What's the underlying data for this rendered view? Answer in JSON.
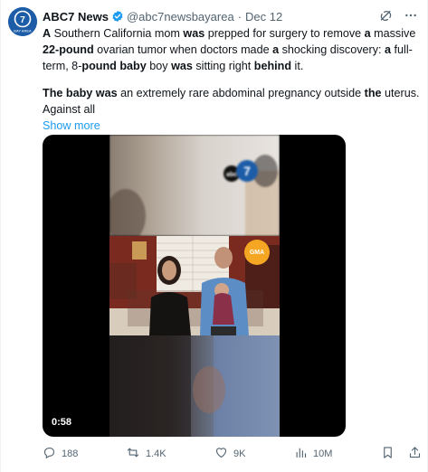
{
  "tweet": {
    "author": {
      "display_name": "ABC7 News",
      "handle": "@abc7newsbayarea",
      "date": "Dec 12",
      "avatar_text": "BAY AREA"
    },
    "body": {
      "p1": [
        {
          "t": "A",
          "b": true
        },
        {
          "t": " Southern California mom ",
          "b": false
        },
        {
          "t": "was",
          "b": true
        },
        {
          "t": " prepped for surgery to remove ",
          "b": false
        },
        {
          "t": "a",
          "b": true
        },
        {
          "t": " massive ",
          "b": false
        },
        {
          "t": "22-pound",
          "b": true
        },
        {
          "t": " ovarian tumor when doctors made ",
          "b": false
        },
        {
          "t": "a",
          "b": true
        },
        {
          "t": " shocking discovery: ",
          "b": false
        },
        {
          "t": "a",
          "b": true
        },
        {
          "t": " full-term, 8-",
          "b": false
        },
        {
          "t": "pound baby",
          "b": true
        },
        {
          "t": " boy ",
          "b": false
        },
        {
          "t": "was",
          "b": true
        },
        {
          "t": " sitting right ",
          "b": false
        },
        {
          "t": "behind",
          "b": true
        },
        {
          "t": " it.",
          "b": false
        }
      ],
      "p2": [
        {
          "t": "The baby was",
          "b": true
        },
        {
          "t": " an extremely rare abdominal pregnancy outside ",
          "b": false
        },
        {
          "t": "the",
          "b": true
        },
        {
          "t": " uterus. Against all",
          "b": false
        }
      ],
      "show_more": "Show more"
    },
    "media": {
      "duration": "0:58",
      "badge_top": "abc7",
      "badge_gma": "GMA"
    },
    "actions": {
      "replies": "188",
      "reposts": "1.4K",
      "likes": "9K",
      "views": "10M"
    }
  },
  "colors": {
    "accent": "#1d9bf0",
    "text": "#0f1419",
    "muted": "#536471",
    "avatar_bg": "#1d5da8"
  },
  "icons": [
    "verified-badge-icon",
    "grok-icon",
    "more-icon",
    "reply-icon",
    "repost-icon",
    "like-icon",
    "views-icon",
    "bookmark-icon",
    "share-icon"
  ]
}
